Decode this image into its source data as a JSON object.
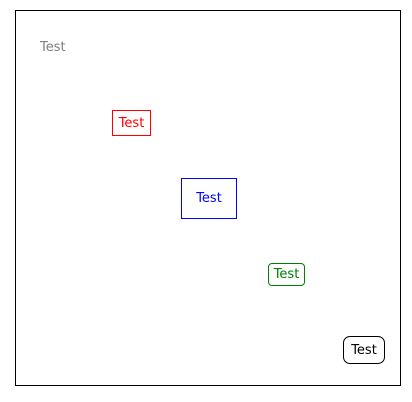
{
  "labels": {
    "plain": {
      "text": "Test",
      "color": "#808080"
    },
    "red_box": {
      "text": "Test",
      "color": "#ff0000"
    },
    "blue_box": {
      "text": "Test",
      "color": "#0000ff"
    },
    "green_box": {
      "text": "Test",
      "color": "#008000"
    },
    "black_box": {
      "text": "Test",
      "color": "#000000"
    }
  }
}
